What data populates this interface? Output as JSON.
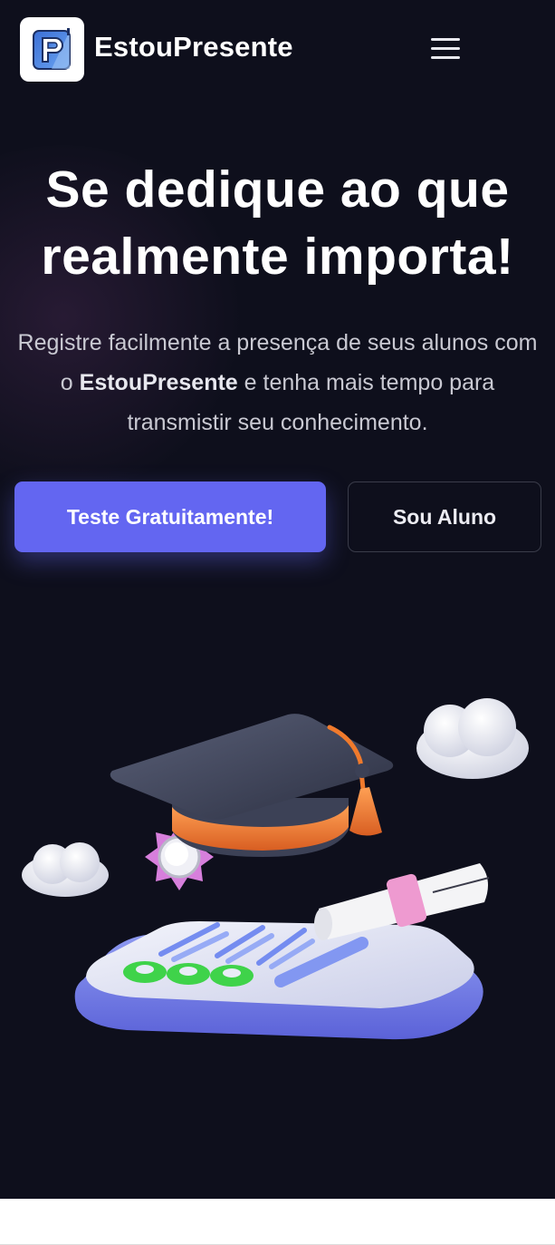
{
  "header": {
    "brand_name": "EstouPresente",
    "logo_icon": "estoupresente-logo-icon",
    "menu_icon": "hamburger-menu-icon"
  },
  "hero": {
    "headline_line1": "Se dedique ao que",
    "headline_line2": "realmente importa!",
    "subtitle_part1": "Registre facilmente a presença de seus alunos com o ",
    "subtitle_brand": "EstouPresente",
    "subtitle_part2": " e tenha mais tempo para transmistir seu conhecimento.",
    "primary_button_label": "Teste Gratuitamente!",
    "secondary_button_label": "Sou Aluno",
    "illustration_icon": "graduation-attendance-illustration"
  },
  "colors": {
    "background": "#0e0f1c",
    "primary": "#6366f1",
    "text": "#ffffff",
    "muted_text": "#c9c9d2"
  }
}
